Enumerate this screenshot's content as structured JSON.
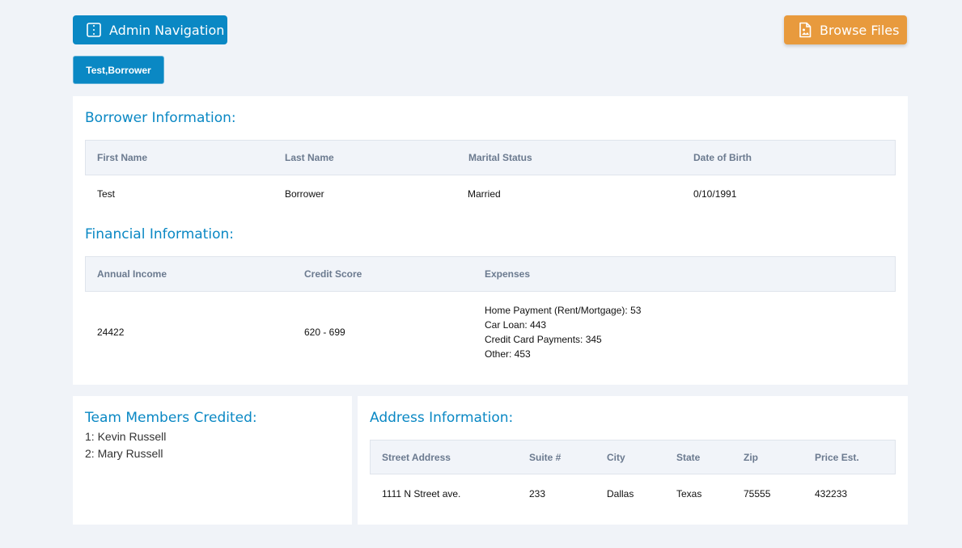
{
  "header": {
    "admin_nav_label": "Admin Navigation",
    "browse_files_label": "Browse Files",
    "borrower_chip": "Test,Borrower"
  },
  "colors": {
    "primary": "#0a88c4",
    "accent_orange": "#e89a3d",
    "page_background": "#f0f3f8"
  },
  "borrower": {
    "title": "Borrower Information:",
    "columns": [
      "First Name",
      "Last Name",
      "Marital Status",
      "Date of Birth"
    ],
    "row": [
      "Test",
      "Borrower",
      "Married",
      "0/10/1991"
    ]
  },
  "financial": {
    "title": "Financial Information:",
    "columns": [
      "Annual Income",
      "Credit Score",
      "Expenses"
    ],
    "annual_income": "24422",
    "credit_score": "620 - 699",
    "expenses": [
      "Home Payment (Rent/Mortgage): 53",
      "Car Loan: 443",
      "Credit Card Payments: 345",
      "Other: 453"
    ]
  },
  "team": {
    "title": "Team Members Credited:",
    "members": [
      "1: Kevin Russell",
      "2: Mary Russell"
    ]
  },
  "address": {
    "title": "Address Information:",
    "columns": [
      "Street Address",
      "Suite #",
      "City",
      "State",
      "Zip",
      "Price Est."
    ],
    "row": [
      "1111 N Street ave.",
      "233",
      "Dallas",
      "Texas",
      "75555",
      "432233"
    ]
  }
}
